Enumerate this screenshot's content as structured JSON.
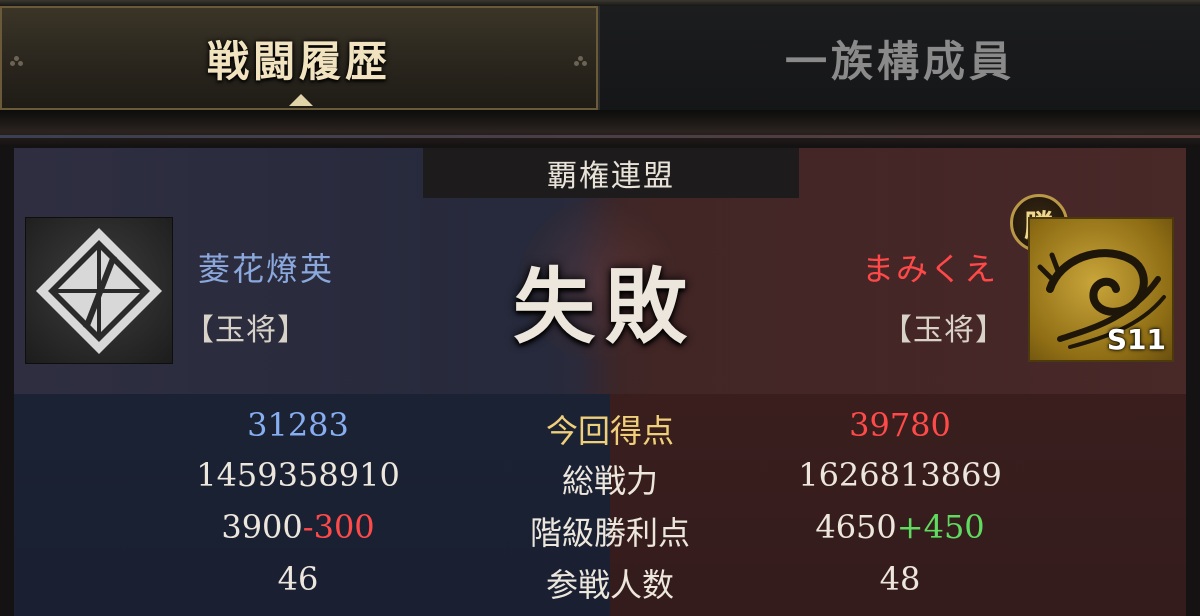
{
  "tabs": [
    {
      "label": "戦闘履歴",
      "active": true
    },
    {
      "label": "一族構成員",
      "active": false
    }
  ],
  "battle": {
    "alliance": "覇権連盟",
    "result": "失敗",
    "win_badge": "勝",
    "left": {
      "name": "菱花燎英",
      "rank": "【玉将】"
    },
    "right": {
      "name": "まみくえ",
      "rank": "【玉将】",
      "season": "S11"
    }
  },
  "stats": [
    {
      "label": "今回得点",
      "left": "31283",
      "right": "39780"
    },
    {
      "label": "総戦力",
      "left": "1459358910",
      "right": "1626813869"
    },
    {
      "label": "階級勝利点",
      "left_base": "3900",
      "left_delta": "-300",
      "right_base": "4650",
      "right_delta": "+450"
    },
    {
      "label": "参戦人数",
      "left": "46",
      "right": "48"
    }
  ],
  "colors": {
    "left_accent": "#86aef0",
    "right_accent": "#ff4a4a",
    "gain": "#5fdc5f",
    "highlight_label": "#f0cf7a"
  }
}
